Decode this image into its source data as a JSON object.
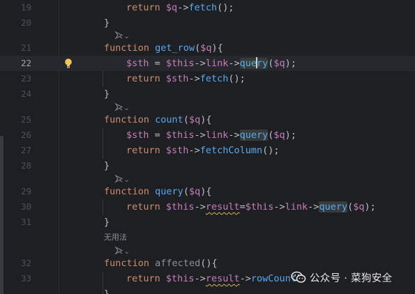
{
  "editor": {
    "current_line": "22",
    "lines": [
      {
        "num": "19"
      },
      {
        "num": "20"
      },
      {
        "num": "21"
      },
      {
        "num": "22"
      },
      {
        "num": "23"
      },
      {
        "num": "24"
      },
      {
        "num": "25"
      },
      {
        "num": "26"
      },
      {
        "num": "27"
      },
      {
        "num": "28"
      },
      {
        "num": "29"
      },
      {
        "num": "30"
      },
      {
        "num": "31"
      },
      {
        "num": "32"
      },
      {
        "num": "33"
      }
    ],
    "tokens": {
      "return": "return",
      "function": "function",
      "q_var": "$q",
      "q_param": "$q",
      "arrow": "->",
      "fetch_call": "fetch",
      "paren_close_semi": "();",
      "close_brace": "}",
      "get_row_name": "get_row",
      "open_paren": "(",
      "close_paren_brace": "){",
      "sth_var": "$sth",
      "assign": " = ",
      "this_var": "$this",
      "link_prop": "link",
      "query_call_a": "que",
      "query_call_b": "ry",
      "arg_close_semi": ");",
      "count_name": "count",
      "query_call": "query",
      "fetchcolumn_call": "fetchColumn",
      "query_name": "query",
      "result_prop": "result",
      "equals": "=",
      "affected_name": "affected",
      "empty_parens_brace": "(){",
      "rowcount_call": "rowCount"
    },
    "usage_hint_chevron": "⌄",
    "unused_hint": "无用法"
  },
  "watermark": {
    "text": "公众号 · 菜狗安全"
  },
  "colors": {
    "background": "#1e1f22",
    "keyword": "#cf8e6d",
    "function": "#56a8f5",
    "variable": "#c77dbb",
    "plain": "#bcbec4",
    "line_number": "#4b5059",
    "current_line": "#26282e"
  },
  "icons": {
    "bulb": "lightbulb-icon",
    "hint": "ai-hint-icon",
    "watermark": "wechat-icon"
  }
}
